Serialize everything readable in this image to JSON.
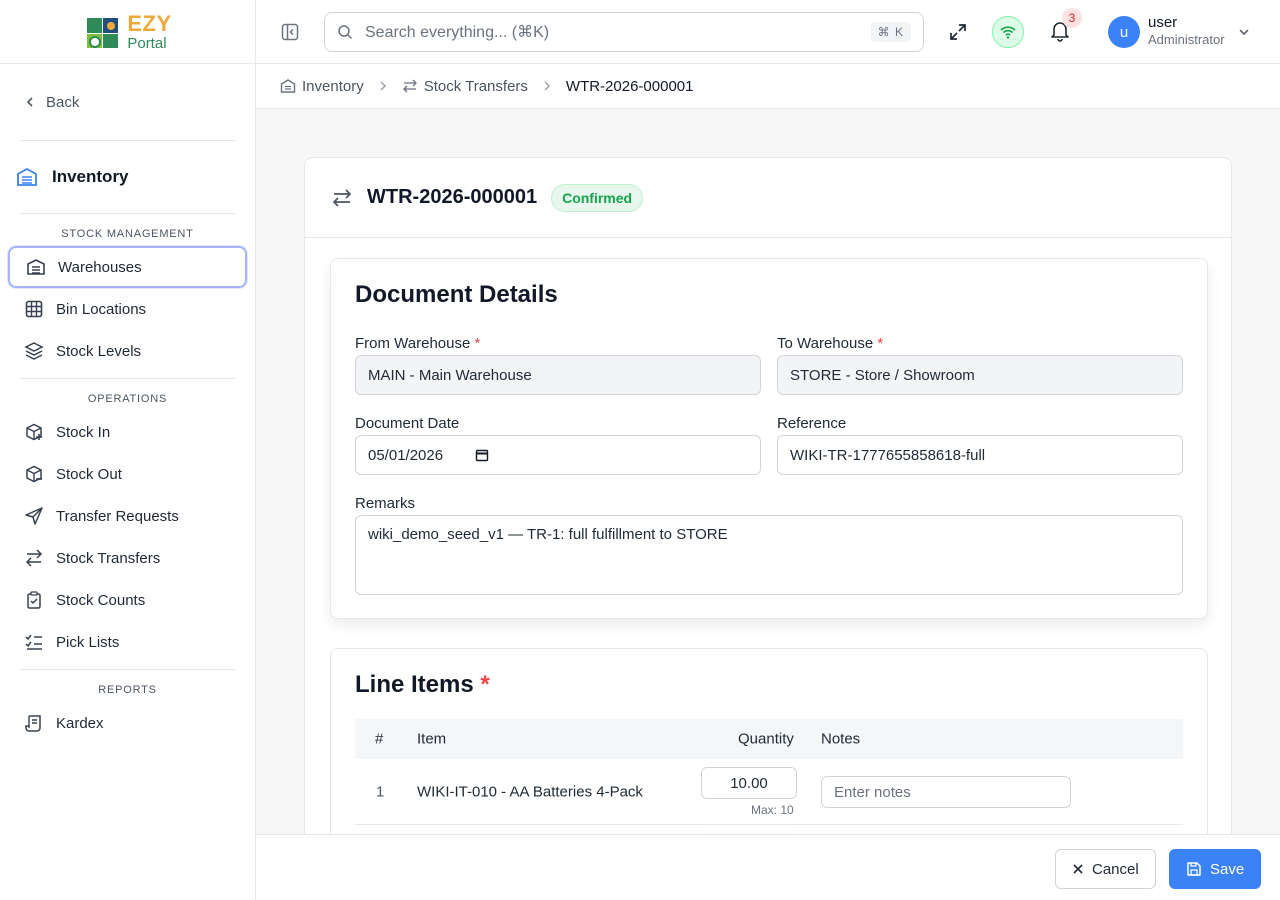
{
  "app": {
    "logo_top": "EZY",
    "logo_bottom": "Portal"
  },
  "sidebar": {
    "back_label": "Back",
    "module_title": "Inventory",
    "sections": [
      {
        "label": "STOCK MANAGEMENT"
      },
      {
        "label": "OPERATIONS"
      },
      {
        "label": "REPORTS"
      }
    ],
    "items": {
      "warehouses": "Warehouses",
      "bin_locations": "Bin Locations",
      "stock_levels": "Stock Levels",
      "stock_in": "Stock In",
      "stock_out": "Stock Out",
      "transfer_requests": "Transfer Requests",
      "stock_transfers": "Stock Transfers",
      "stock_counts": "Stock Counts",
      "pick_lists": "Pick Lists",
      "kardex": "Kardex"
    },
    "active": "warehouses"
  },
  "header": {
    "search_placeholder": "Search everything... (⌘K)",
    "search_shortcut": "⌘ K",
    "notification_count": "3",
    "user_initial": "u",
    "user_name": "user",
    "user_role": "Administrator"
  },
  "breadcrumb": [
    "Inventory",
    "Stock Transfers",
    "WTR-2026-000001"
  ],
  "document": {
    "number": "WTR-2026-000001",
    "status": "Confirmed",
    "status_color": "#16a34a",
    "details_title": "Document Details",
    "from_label": "From Warehouse",
    "from_value": "MAIN - Main Warehouse",
    "to_label": "To Warehouse",
    "to_value": "STORE - Store / Showroom",
    "date_label": "Document Date",
    "date_value": "05/01/2026",
    "reference_label": "Reference",
    "reference_value": "WIKI-TR-1777655858618-full",
    "remarks_label": "Remarks",
    "remarks_value": "wiki_demo_seed_v1 — TR-1: full fulfillment to STORE",
    "required_mark": "*"
  },
  "line_items": {
    "title": "Line Items",
    "columns": [
      "#",
      "Item",
      "Quantity",
      "Notes"
    ],
    "rows": [
      {
        "index": "1",
        "item": "WIKI-IT-010 - AA Batteries 4-Pack",
        "quantity": "10.00",
        "max": "Max: 10",
        "notes_placeholder": "Enter notes"
      }
    ]
  },
  "footer": {
    "cancel_label": "Cancel",
    "save_label": "Save"
  },
  "colors": {
    "accent": "#3b82f6",
    "required": "#ef4444",
    "logo_orange": "#f2a93b",
    "logo_green": "#2e8b57"
  }
}
